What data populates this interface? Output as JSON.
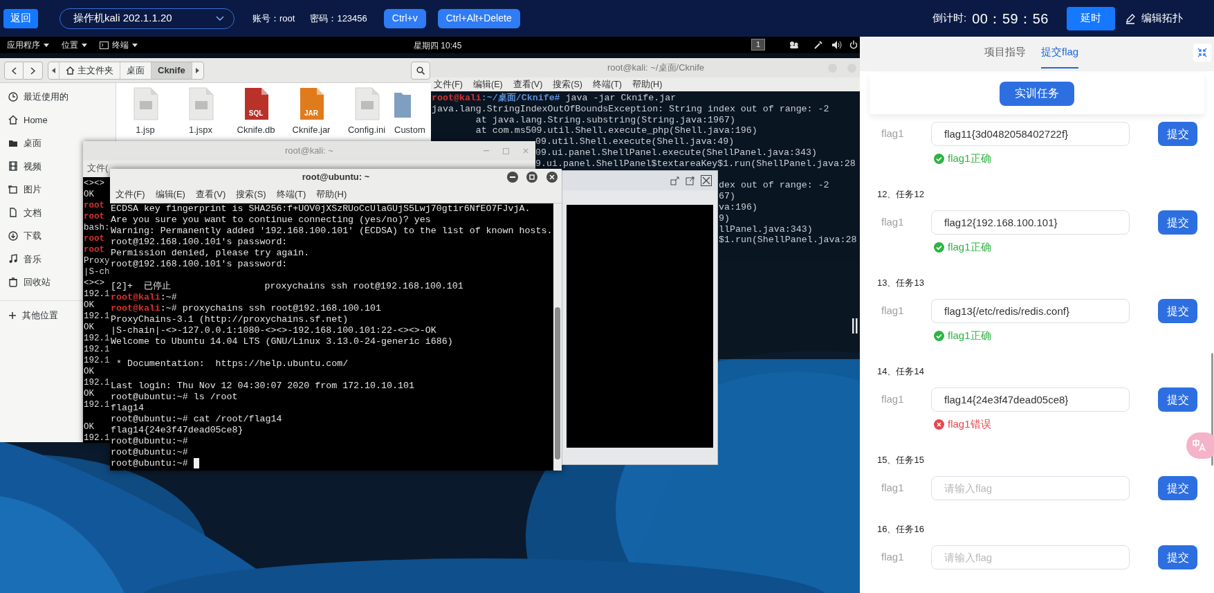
{
  "toolbar": {
    "back": "返回",
    "machine": "操作机kali 202.1.1.20",
    "account": "账号：root",
    "password": "密码：123456",
    "keys": [
      "Ctrl+v",
      "Ctrl+Alt+Delete"
    ],
    "countdown_label": "倒计时:",
    "countdown": "00：59：56",
    "extend": "延时",
    "edit_topology": "编辑拓扑"
  },
  "desktop": {
    "top_bar": {
      "menus": [
        "应用程序",
        "位置",
        "终端"
      ],
      "clock": "星期四 10:45",
      "workspace": "1"
    },
    "file_manager": {
      "path": [
        {
          "label": "主文件夹",
          "selected": false
        },
        {
          "label": "桌面",
          "selected": false
        },
        {
          "label": "Cknife",
          "selected": true
        }
      ],
      "sidebar": [
        "最近使用的",
        "Home",
        "桌面",
        "视频",
        "图片",
        "文档",
        "下载",
        "音乐",
        "回收站"
      ],
      "other_places": "其他位置",
      "files": [
        {
          "name": "1.jsp",
          "kind": "document"
        },
        {
          "name": "1.jspx",
          "kind": "document"
        },
        {
          "name": "Cknife.db",
          "kind": "badge",
          "badge": "SQL",
          "color": "#b8322a"
        },
        {
          "name": "Cknife.jar",
          "kind": "badge",
          "badge": "JAR",
          "color": "#e07b1c"
        },
        {
          "name": "Config.ini",
          "kind": "document"
        },
        {
          "name": "Custom",
          "kind": "folder"
        }
      ]
    },
    "cknife_terminal": {
      "title": "root@kali: ~/桌面/Cknife",
      "menu": [
        "文件(F)",
        "编辑(E)",
        "查看(V)",
        "搜索(S)",
        "终端(T)",
        "帮助(H)"
      ],
      "lines_top": [
        {
          "kind": "prompt",
          "user": "root@kali",
          "path": ":~/桌面/Cknife#",
          "text": " java -jar Cknife.jar"
        },
        {
          "kind": "output",
          "text": "java.lang.StringIndexOutOfBoundsException: String index out of range: -2"
        },
        {
          "kind": "output",
          "text": "        at java.lang.String.substring(String.java:1967)"
        },
        {
          "kind": "output",
          "text": "        at com.ms509.util.Shell.execute_php(Shell.java:196)"
        },
        {
          "kind": "output",
          "text": "09.util.Shell.execute(Shell.java:49)"
        },
        {
          "kind": "output",
          "text": "09.ui.panel.ShellPanel.execute(ShellPanel.java:343)"
        },
        {
          "kind": "output",
          "text": "9.ui.panel.ShellPanel$textareaKey$1.run(ShellPanel.java:28"
        }
      ],
      "lines_bottom": [
        "dex out of range: -2",
        "67)",
        "va:196)",
        "9)",
        "llPanel.java:343)",
        "$1.run(ShellPanel.java:28"
      ]
    },
    "kali_terminal": {
      "title": "root@kali: ~",
      "menu_visible": "文件(",
      "lines": [
        {
          "kind": "output",
          "text": "<><>"
        },
        {
          "kind": "output",
          "text": "OK"
        },
        {
          "kind": "prompt",
          "text": "root"
        },
        {
          "kind": "prompt",
          "text": "root"
        },
        {
          "kind": "output",
          "text": "bash:"
        },
        {
          "kind": "prompt",
          "text": "root"
        },
        {
          "kind": "prompt",
          "text": "root"
        },
        {
          "kind": "output",
          "text": "Proxy"
        },
        {
          "kind": "output",
          "text": "|S-ch"
        },
        {
          "kind": "output",
          "text": "<><>"
        },
        {
          "kind": "output",
          "text": "192.1"
        },
        {
          "kind": "output",
          "text": "OK"
        },
        {
          "kind": "output",
          "text": "192.1"
        },
        {
          "kind": "output",
          "text": "OK"
        },
        {
          "kind": "output",
          "text": "192.1"
        },
        {
          "kind": "output",
          "text": "192.1"
        },
        {
          "kind": "output",
          "text": "192.1"
        },
        {
          "kind": "output",
          "text": "OK"
        },
        {
          "kind": "output",
          "text": "192.1"
        },
        {
          "kind": "output",
          "text": "OK"
        },
        {
          "kind": "output",
          "text": "192.1"
        },
        {
          "kind": "blank"
        },
        {
          "kind": "output",
          "text": "OK"
        },
        {
          "kind": "output",
          "text": "192.1"
        }
      ]
    },
    "ubuntu_terminal": {
      "title": "root@ubuntu: ~",
      "menu": [
        "文件(F)",
        "编辑(E)",
        "查看(V)",
        "搜索(S)",
        "终端(T)",
        "帮助(H)"
      ],
      "cursor": true,
      "lines": [
        {
          "kind": "output",
          "text": "ECDSA key fingerprint is SHA256:f+UOV0jXSzRUoCcUlaGUjS5Lwj70gtir6NfEO7FJvjA."
        },
        {
          "kind": "output",
          "text": "Are you sure you want to continue connecting (yes/no)? yes"
        },
        {
          "kind": "output",
          "text": "Warning: Permanently added '192.168.100.101' (ECDSA) to the list of known hosts."
        },
        {
          "kind": "output",
          "text": "root@192.168.100.101's password:"
        },
        {
          "kind": "output",
          "text": "Permission denied, please try again."
        },
        {
          "kind": "output",
          "text": "root@192.168.100.101's password:"
        },
        {
          "kind": "blank"
        },
        {
          "kind": "output",
          "text": "[2]+  已停止                 proxychains ssh root@192.168.100.101"
        },
        {
          "kind": "prompt",
          "user": "root@kali",
          "text": ":~#"
        },
        {
          "kind": "prompt",
          "user": "root@kali",
          "text": ":~# proxychains ssh root@192.168.100.101"
        },
        {
          "kind": "output",
          "text": "ProxyChains-3.1 (http://proxychains.sf.net)"
        },
        {
          "kind": "output",
          "text": "|S-chain|-<>-127.0.0.1:1080-<><>-192.168.100.101:22-<><>-OK"
        },
        {
          "kind": "output",
          "text": "Welcome to Ubuntu 14.04 LTS (GNU/Linux 3.13.0-24-generic i686)"
        },
        {
          "kind": "blank"
        },
        {
          "kind": "output",
          "text": " * Documentation:  https://help.ubuntu.com/"
        },
        {
          "kind": "blank"
        },
        {
          "kind": "output",
          "text": "Last login: Thu Nov 12 04:30:07 2020 from 172.10.10.101"
        },
        {
          "kind": "output",
          "text": "root@ubuntu:~# ls /root"
        },
        {
          "kind": "output",
          "text": "flag14"
        },
        {
          "kind": "output",
          "text": "root@ubuntu:~# cat /root/flag14"
        },
        {
          "kind": "output",
          "text": "flag14{24e3f47dead05ce8}"
        },
        {
          "kind": "output",
          "text": "root@ubuntu:~#"
        },
        {
          "kind": "output",
          "text": "root@ubuntu:~#"
        },
        {
          "kind": "output",
          "text": "root@ubuntu:~# "
        }
      ]
    }
  },
  "panel": {
    "tabs": [
      {
        "label": "项目指导",
        "selected": false
      },
      {
        "label": "提交flag",
        "selected": true
      }
    ],
    "task_button": "实训任务",
    "tasks": [
      {
        "label": "flag1",
        "value": "flag11{3d0482058402722f}",
        "submit": "提交",
        "kind": "correct",
        "message": "flag1正确"
      },
      {
        "heading": "12、任务12",
        "label": "flag1",
        "value": "flag12{192.168.100.101}",
        "submit": "提交",
        "kind": "correct",
        "message": "flag1正确"
      },
      {
        "heading": "13、任务13",
        "label": "flag1",
        "value": "flag13{/etc/redis/redis.conf}",
        "submit": "提交",
        "kind": "correct",
        "message": "flag1正确"
      },
      {
        "heading": "14、任务14",
        "label": "flag1",
        "value": "flag14{24e3f47dead05ce8}",
        "submit": "提交",
        "kind": "wrong",
        "message": "flag1错误"
      },
      {
        "heading": "15、任务15",
        "kind": "empty",
        "label": "flag1",
        "placeholder": "请输入flag",
        "submit": "提交"
      },
      {
        "heading": "16、任务16",
        "kind": "empty",
        "label": "flag1",
        "placeholder": "请输入flag",
        "submit": "提交"
      }
    ]
  }
}
